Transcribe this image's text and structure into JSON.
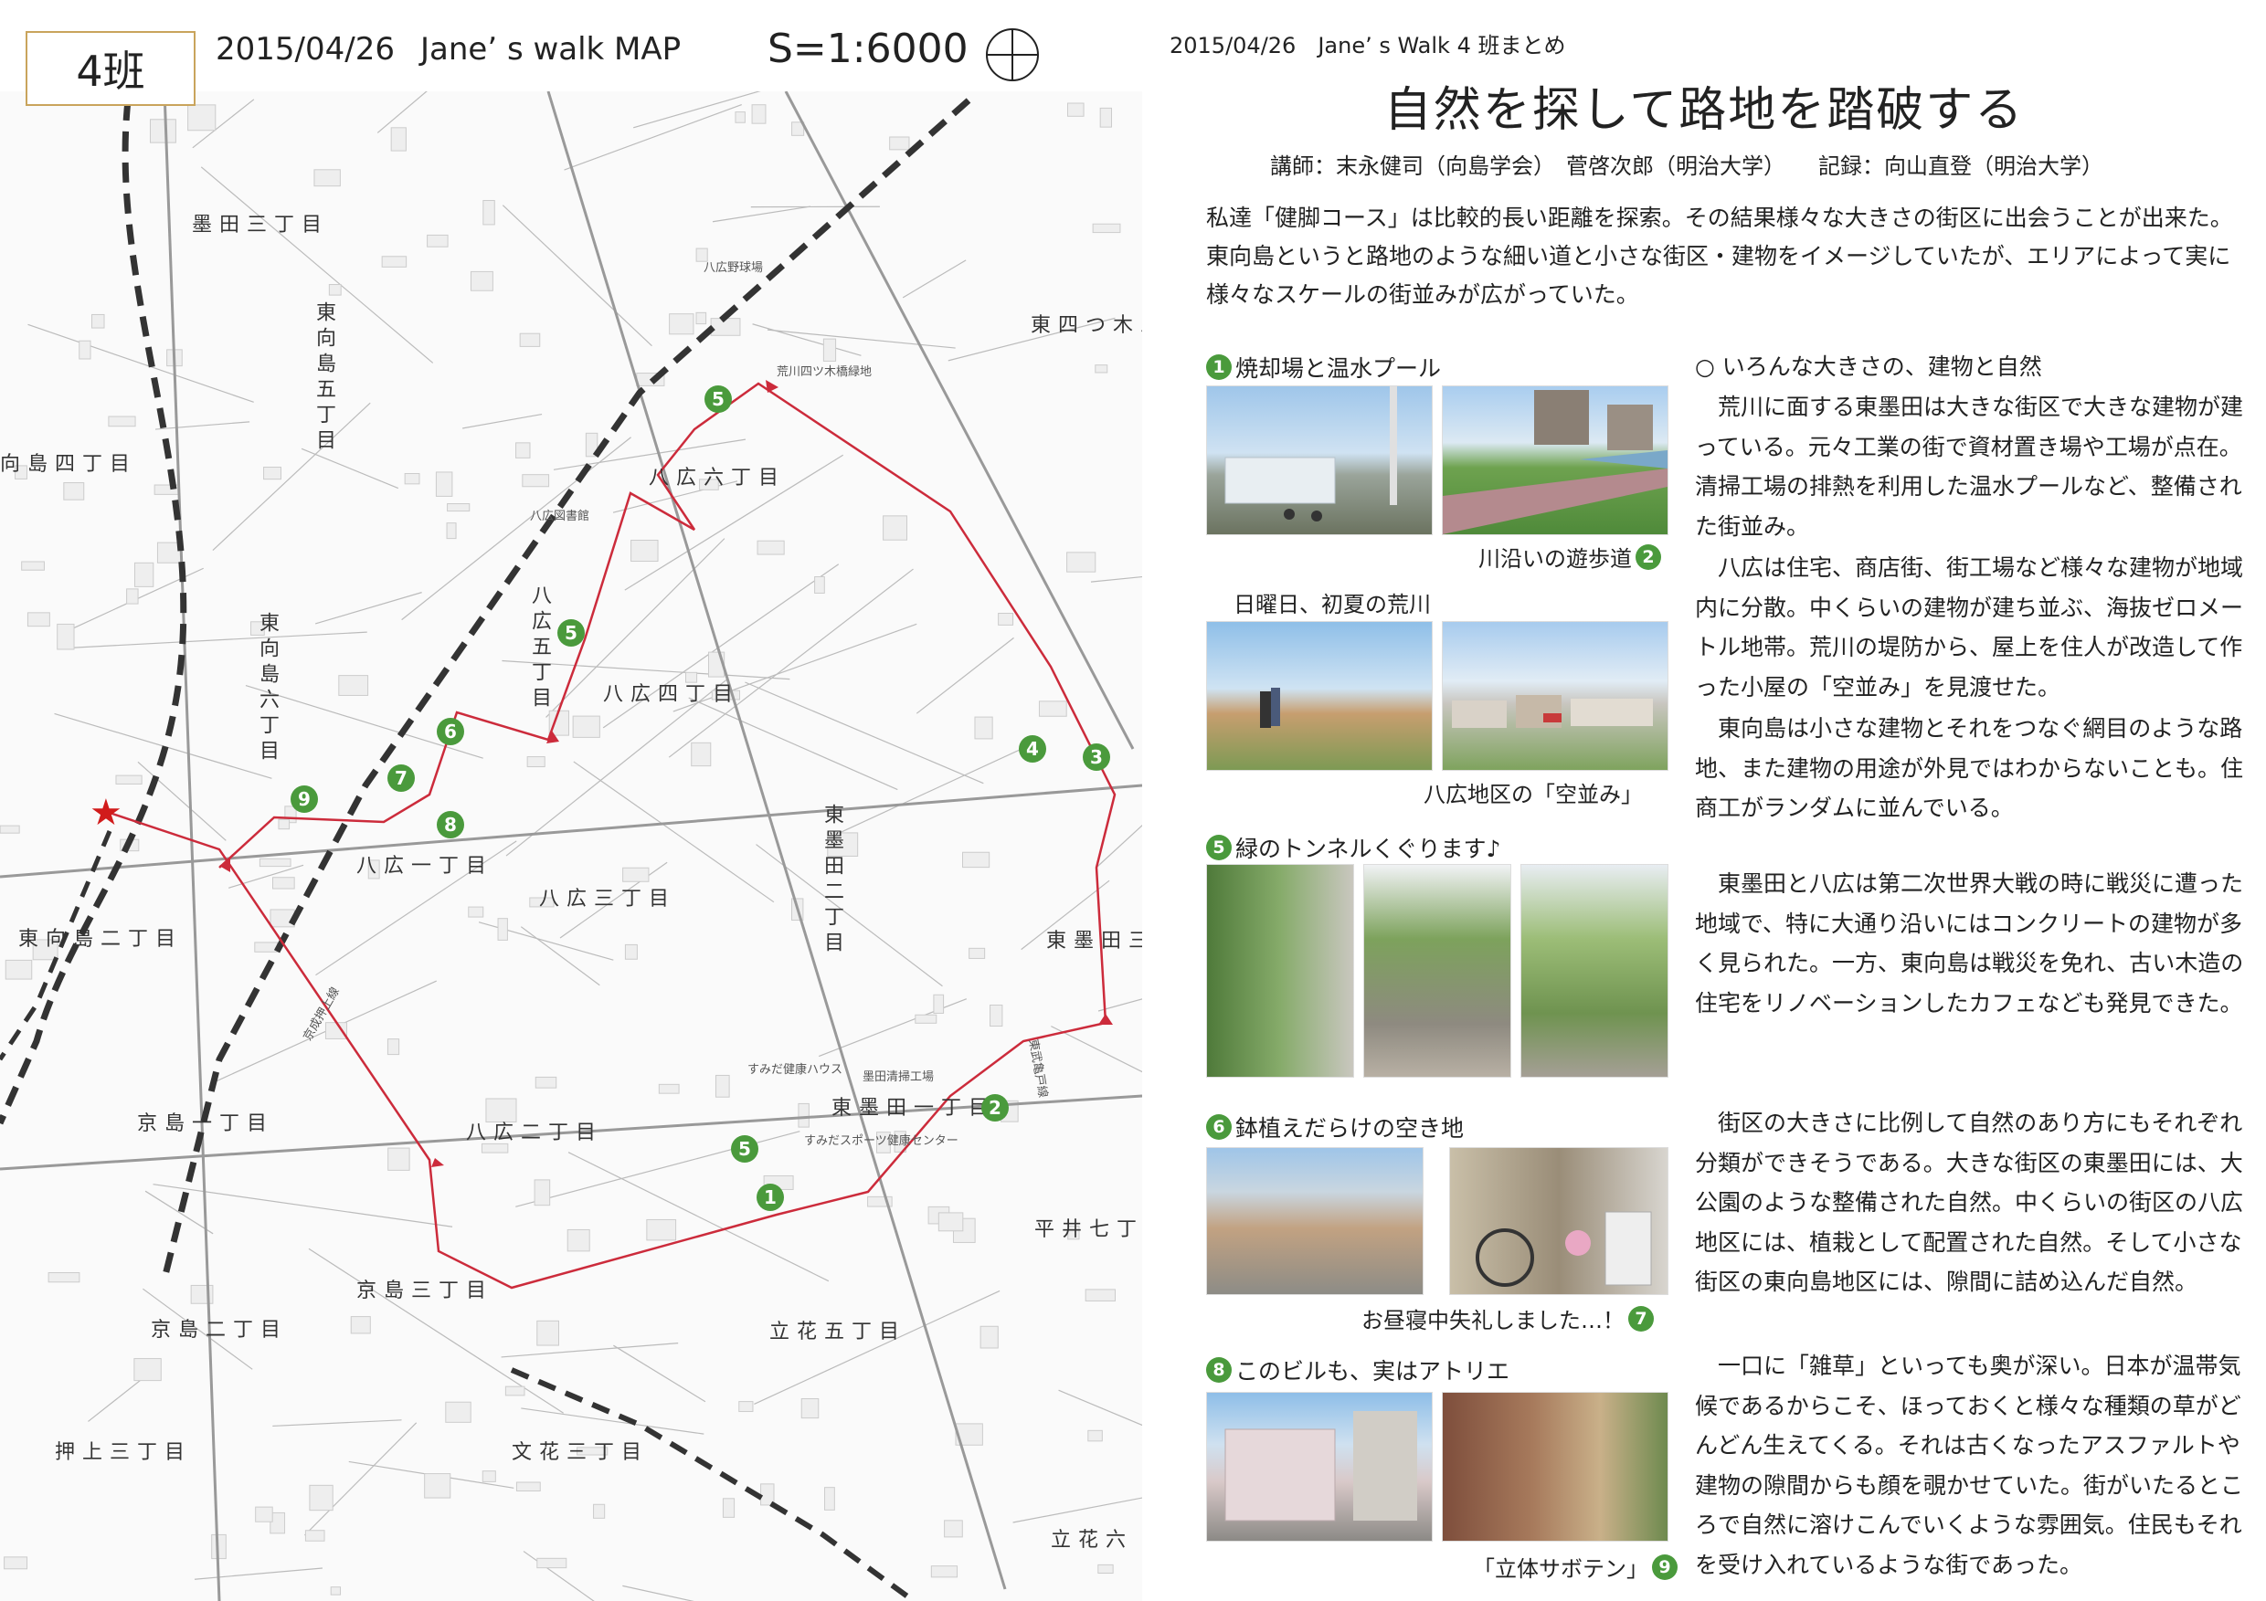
{
  "map": {
    "team": "4班",
    "date": "2015/04/26",
    "title": "Jane’ s walk MAP",
    "scale": "S=1:6000",
    "labels": {
      "sumida3": "墨田三丁目",
      "higashimukojima5": "東向島五丁目",
      "higashimukojima4": "向島四丁目",
      "higashimukojima6": "東向島六丁目",
      "higashimukojima2": "東向島二丁目",
      "yahiro6": "八広六丁目",
      "yahiro5": "八広五丁目",
      "yahiro4": "八広四丁目",
      "yahiro3": "八広三丁目",
      "yahiro2": "八広二丁目",
      "yahiro1": "八広一丁目",
      "higashisumida2": "東墨田二丁目",
      "higashisumida1": "東墨田一丁目",
      "higashisumida3": "東墨田三",
      "higashiyotsugi3": "東四つ木三",
      "kyojima1": "京島一丁目",
      "kyojima2": "京島二丁目",
      "kyojima3": "京島三丁目",
      "oshiage3": "押上三丁目",
      "bunka3": "文花三丁目",
      "tachibana5": "立花五丁目",
      "tachibana6": "立花六",
      "hirai7": "平井七丁目",
      "arakawa_green": "荒川四ツ木橋緑地",
      "yahiro_field": "八広野球場",
      "yahiro_library": "八広図書館",
      "sumida_pool": "すみだスポーツ健康センター",
      "sumida_health": "すみだ健康ハウス",
      "sumida_clean": "墨田清掃工場",
      "keisei": "京成押上線",
      "tobu": "東武亀戸線"
    },
    "markers": [
      "5",
      "5",
      "5",
      "4",
      "3",
      "6",
      "7",
      "9",
      "8",
      "2",
      "1"
    ]
  },
  "report": {
    "header": "2015/04/26　Jane’ s Walk 4 班まとめ",
    "title": "自然を探して路地を踏破する",
    "credits": "講師：末永健司（向島学会）　菅啓次郎（明治大学）　　記録：向山直登（明治大学）",
    "intro": "私達「健脚コース」は比較的長い距離を探索。その結果様々な大きさの街区に出会うことが出来た。東向島というと路地のような細い道と小さな街区・建物をイメージしていたが、エリアによって実に様々なスケールの街並みが広がっていた。",
    "sections": {
      "s1": {
        "num": "1",
        "label": "焼却場と温水プール"
      },
      "s2": {
        "num": "2",
        "label": "川沿いの遊歩道"
      },
      "s3_caption": "日曜日、初夏の荒川",
      "s4_caption": "八広地区の「空並み」",
      "s5": {
        "num": "5",
        "label": "緑のトンネルくぐります♪"
      },
      "s6": {
        "num": "6",
        "label": "鉢植えだらけの空き地"
      },
      "s7": {
        "num": "7",
        "label": "お昼寝中失礼しました…！"
      },
      "s8": {
        "num": "8",
        "label": "このビルも、実はアトリエ"
      },
      "s9": {
        "num": "9",
        "label": "「立体サボテン」"
      }
    },
    "body": {
      "heading": "○ いろんな大きさの、建物と自然",
      "p1": "　荒川に面する東墨田は大きな街区で大きな建物が建っている。元々工業の街で資材置き場や工場が点在。清掃工場の排熱を利用した温水プールなど、整備された街並み。",
      "p2": "　八広は住宅、商店街、街工場など様々な建物が地域内に分散。中くらいの建物が建ち並ぶ、海抜ゼロメートル地帯。荒川の堤防から、屋上を住人が改造して作った小屋の「空並み」を見渡せた。",
      "p3": "　東向島は小さな建物とそれをつなぐ網目のような路地、また建物の用途が外見ではわからないことも。住商工がランダムに並んでいる。",
      "p4": "　東墨田と八広は第二次世界大戦の時に戦災に遭った地域で、特に大通り沿いにはコンクリートの建物が多く見られた。一方、東向島は戦災を免れ、古い木造の住宅をリノベーションしたカフェなども発見できた。",
      "p5": "　街区の大きさに比例して自然のあり方にもそれぞれ分類ができそうである。大きな街区の東墨田には、大公園のような整備された自然。中くらいの街区の八広地区には、植栽として配置された自然。そして小さな街区の東向島地区には、隙間に詰め込んだ自然。",
      "p6": "　一口に「雑草」といっても奥が深い。日本が温帯気候であるからこそ、ほっておくと様々な種類の草がどんどん生えてくる。それは古くなったアスファルトや建物の隙間からも顔を覗かせていた。街がいたるところで自然に溶けこんでいくような雰囲気。住民もそれを受け入れているような街であった。"
    }
  },
  "colors": {
    "route": "#cc2b3b",
    "rail": "#333333",
    "marker": "#4a9a3c",
    "start_star": "#d11b1b",
    "frame": "#c9a45c"
  }
}
